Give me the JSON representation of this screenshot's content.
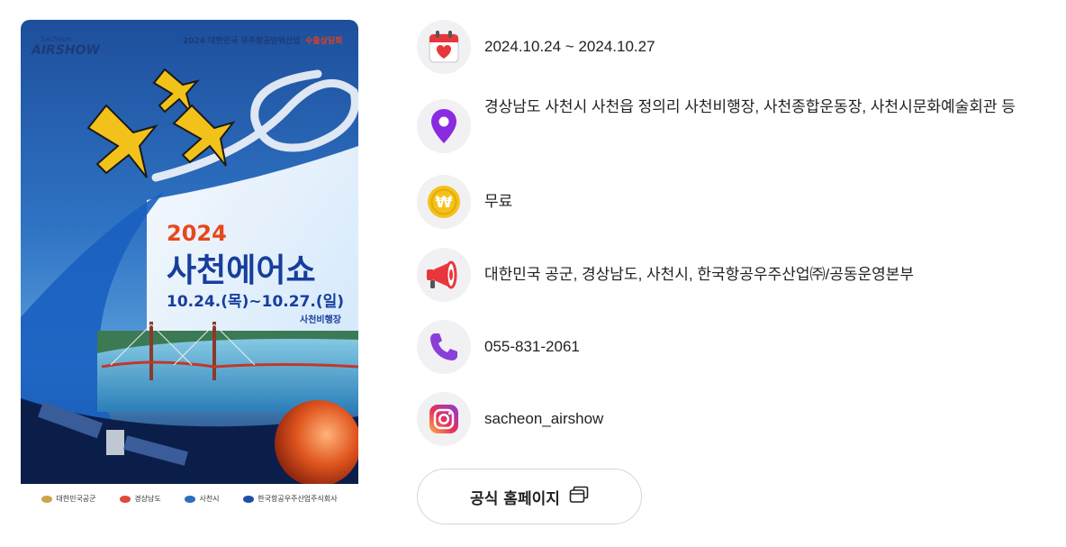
{
  "poster": {
    "logo_small": "Sacheon",
    "logo_main": "AIRSHOW",
    "top_banner": "2024 대한민국 우주항공방위산업",
    "top_banner_highlight": "수출상담회",
    "year": "2024",
    "title": "사천에어쇼",
    "dates": "10.24.(목)~10.27.(일)",
    "venue": "사천비행장",
    "sponsors": [
      "대한민국공군",
      "경상남도",
      "사천시",
      "한국항공우주산업주식회사"
    ]
  },
  "info": {
    "date": "2024.10.24 ~ 2024.10.27",
    "location": "경상남도 사천시 사천읍 정의리 사천비행장, 사천종합운동장, 사천시문화예술회관 등",
    "fee": "무료",
    "organizer": "대한민국 공군, 경상남도, 사천시, 한국항공우주산업㈜/공동운영본부",
    "phone": "055-831-2061",
    "instagram": "sacheon_airshow"
  },
  "icons": {
    "date": "calendar-heart-icon",
    "location": "map-pin-icon",
    "fee": "won-coin-icon",
    "organizer": "megaphone-icon",
    "phone": "phone-icon",
    "instagram": "instagram-icon",
    "homepage": "external-window-icon"
  },
  "buttons": {
    "homepage": "공식 홈페이지"
  },
  "colors": {
    "icon_bg": "#f1f1f4",
    "pin": "#8a2be2",
    "phone": "#8b3fd9",
    "coin": "#f4c21a",
    "megaphone": "#e8373c",
    "calendar": "#e8373c"
  }
}
